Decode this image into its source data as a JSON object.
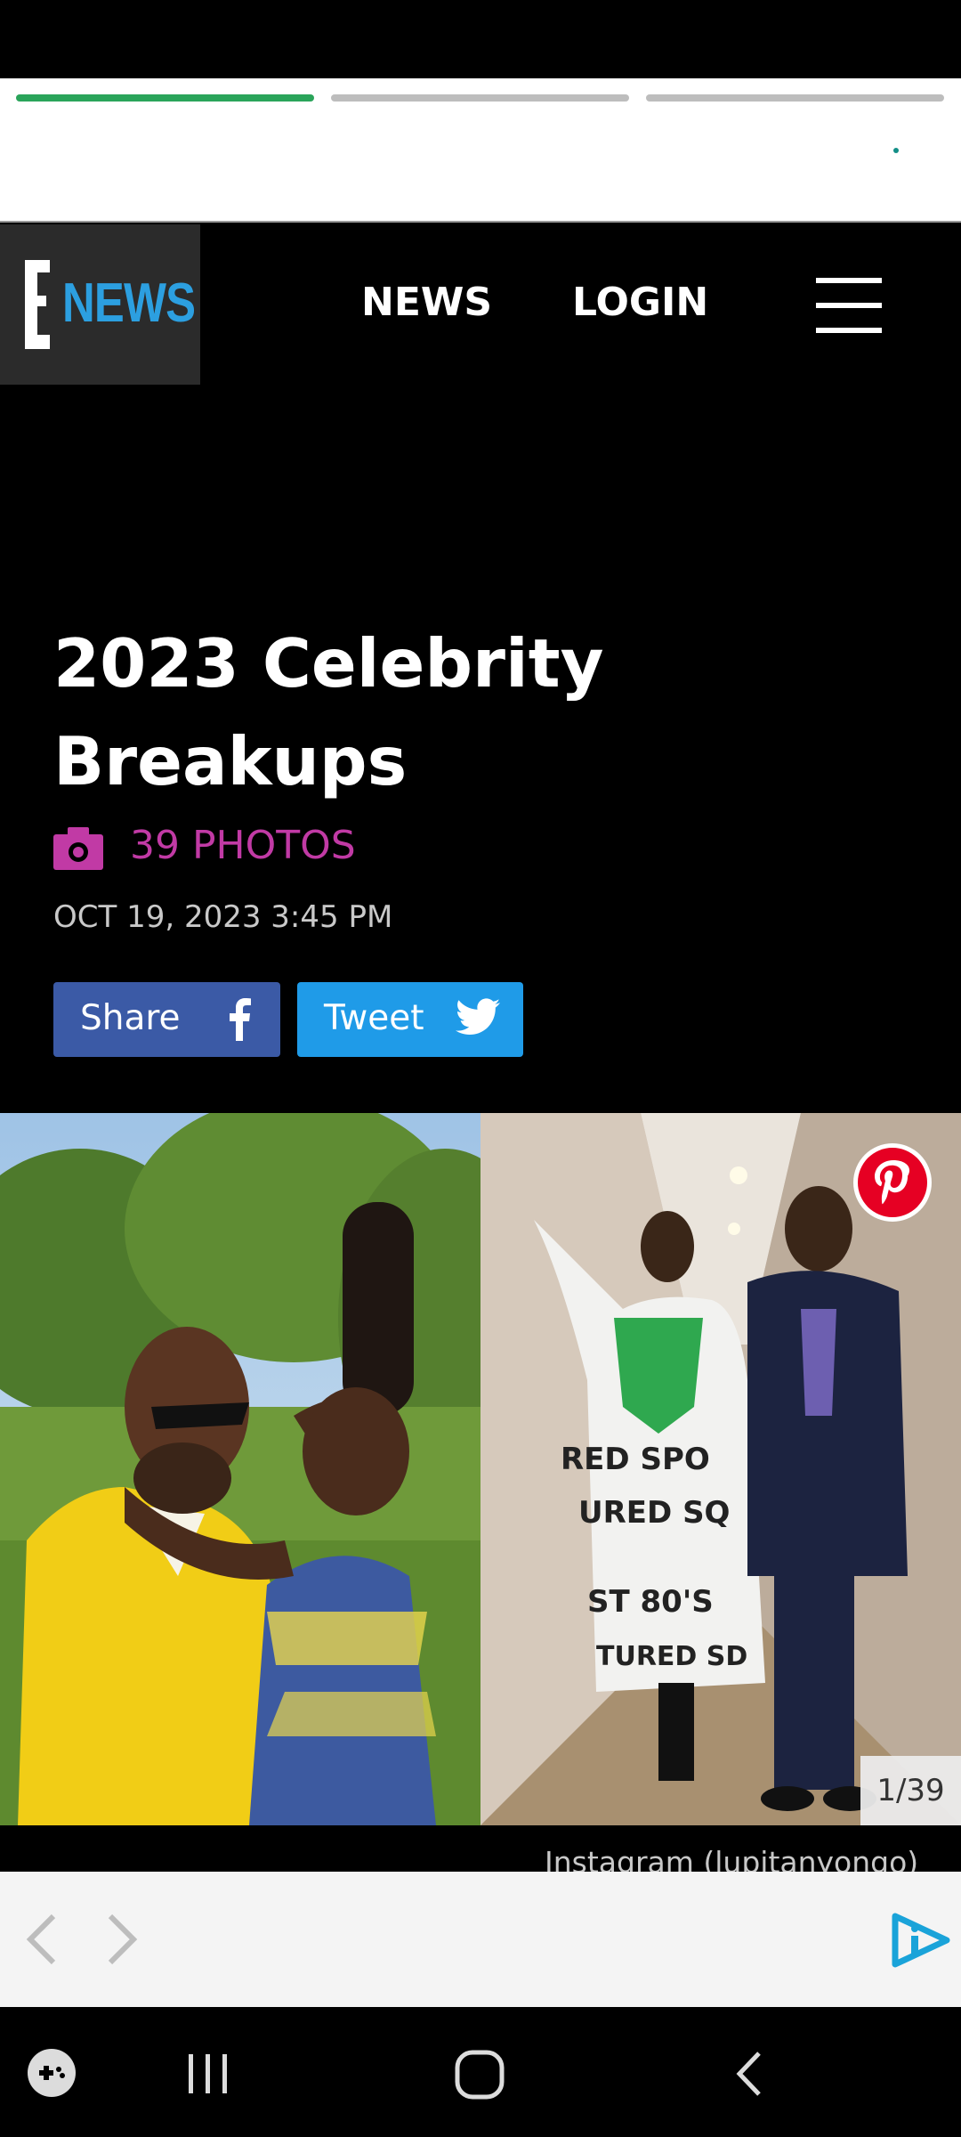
{
  "header": {
    "logo_letter": "E",
    "logo_text": "NEWS",
    "nav": [
      {
        "label": "NEWS"
      },
      {
        "label": "LOGIN"
      }
    ]
  },
  "gallery": {
    "title": "2023 Celebrity Breakups",
    "photo_count": "39 PHOTOS",
    "date": "OCT 19, 2023 3:45 PM",
    "share_label": "Share",
    "tweet_label": "Tweet",
    "counter": "1/39",
    "credit": "Instagram (lupitanyongo)"
  },
  "colors": {
    "progress_active": "#2aa45a",
    "accent_magenta": "#c13aa5",
    "facebook_blue": "#3b5aa6",
    "twitter_blue": "#1f9be8",
    "logo_blue": "#2c9fe0"
  },
  "icons": [
    "camera-icon",
    "facebook-icon",
    "twitter-icon",
    "pinterest-icon",
    "menu-icon",
    "chevron-left-icon",
    "chevron-right-icon",
    "ad-choices-icon",
    "game-launcher-icon",
    "recent-apps-icon",
    "home-icon",
    "back-icon"
  ]
}
